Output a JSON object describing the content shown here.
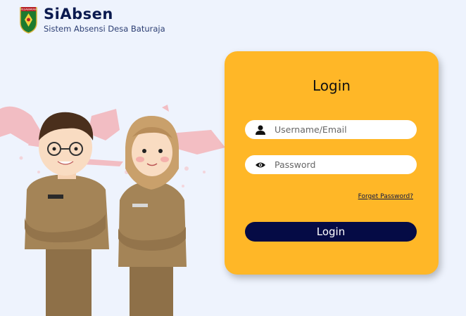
{
  "brand": {
    "title": "SiAbsen",
    "subtitle": "Sistem Absensi Desa Baturaja",
    "logo_text": "PESAWARAN"
  },
  "login": {
    "title": "Login",
    "username_placeholder": "Username/Email",
    "password_placeholder": "Password",
    "forgot_label": "Forget Password?",
    "button_label": "Login"
  },
  "colors": {
    "background": "#eef3fd",
    "card": "#ffb727",
    "button": "#050b45",
    "brand_text": "#0b1a4f"
  },
  "icons": {
    "user": "user-icon",
    "password": "eye-icon"
  }
}
